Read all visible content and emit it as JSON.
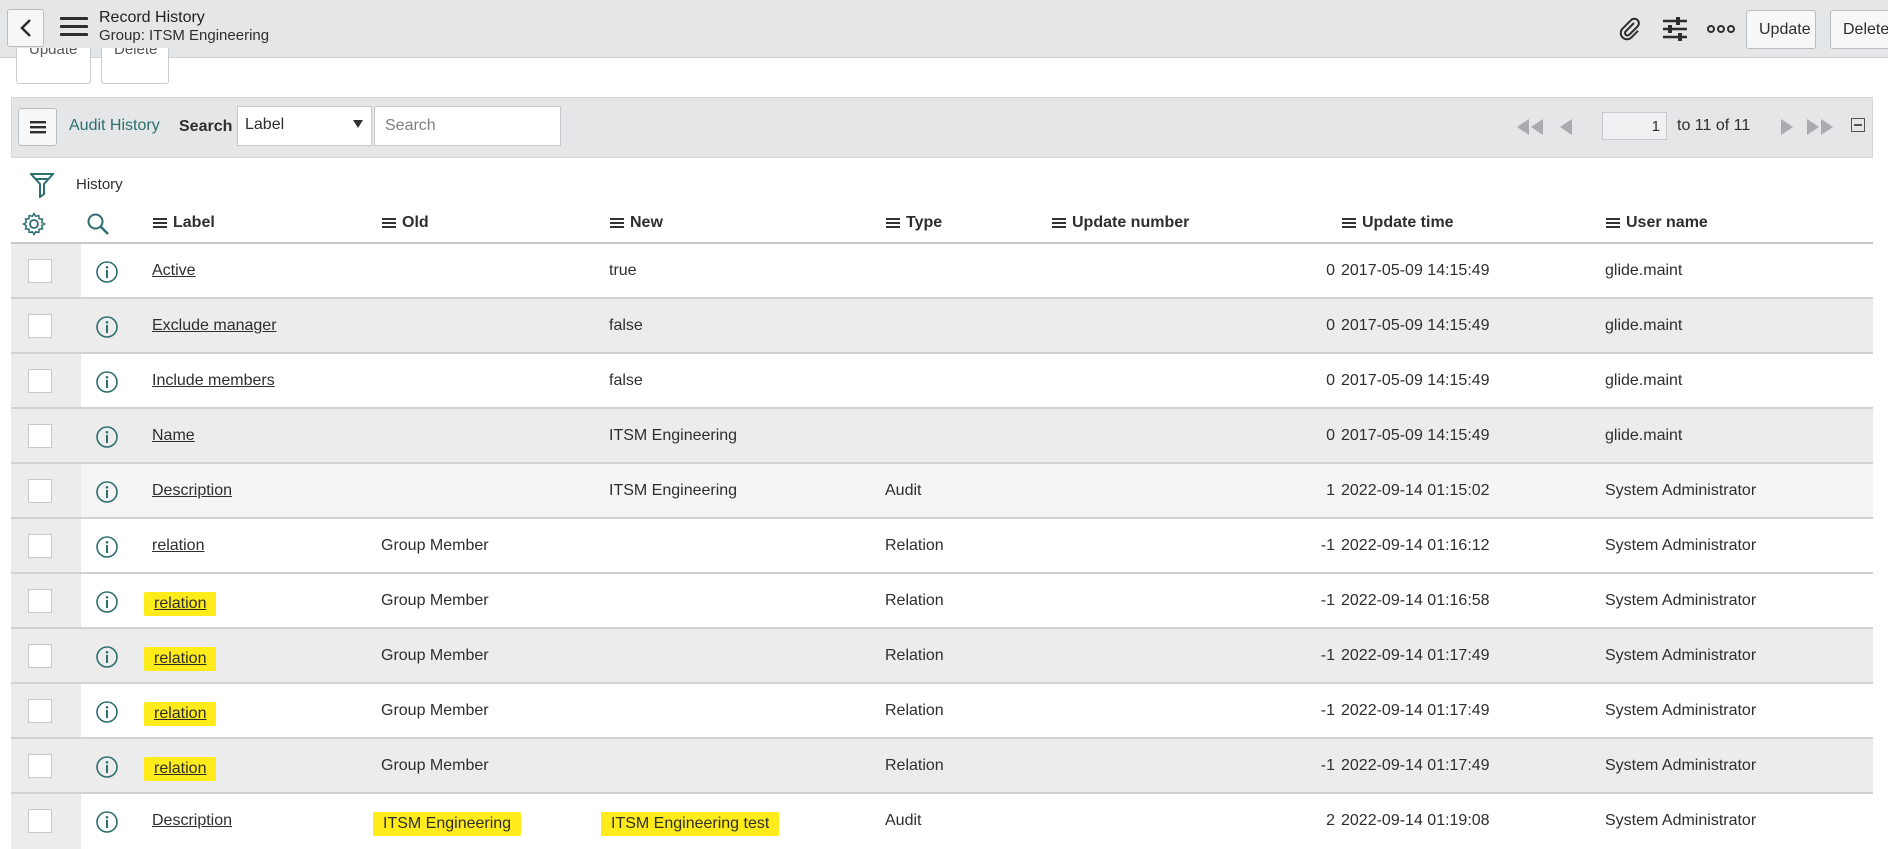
{
  "header": {
    "title": "Record History",
    "subtitle": "Group: ITSM Engineering",
    "update_label": "Update",
    "delete_label": "Delete"
  },
  "peek_buttons": {
    "update_label": "Update",
    "delete_label": "Delete"
  },
  "toolbar": {
    "list_title": "Audit History",
    "search_label": "Search",
    "search_field_selected": "Label",
    "search_placeholder": "Search",
    "page_current": "1",
    "page_range": "to 11 of 11"
  },
  "filter": {
    "breadcrumb": "History"
  },
  "columns": [
    "Label",
    "Old",
    "New",
    "Type",
    "Update number",
    "Update time",
    "User name"
  ],
  "rows": [
    {
      "label": "Active",
      "old": "",
      "new": "true",
      "type": "",
      "update_number": "0",
      "update_time": "2017-05-09 14:15:49",
      "user": "glide.maint"
    },
    {
      "label": "Exclude manager",
      "old": "",
      "new": "false",
      "type": "",
      "update_number": "0",
      "update_time": "2017-05-09 14:15:49",
      "user": "glide.maint"
    },
    {
      "label": "Include members",
      "old": "",
      "new": "false",
      "type": "",
      "update_number": "0",
      "update_time": "2017-05-09 14:15:49",
      "user": "glide.maint"
    },
    {
      "label": "Name",
      "old": "",
      "new": "ITSM Engineering",
      "type": "",
      "update_number": "0",
      "update_time": "2017-05-09 14:15:49",
      "user": "glide.maint"
    },
    {
      "label": "Description",
      "old": "",
      "new": "ITSM Engineering",
      "type": "Audit",
      "update_number": "1",
      "update_time": "2022-09-14 01:15:02",
      "user": "System Administrator"
    },
    {
      "label": "relation",
      "old": "Group Member",
      "new": "",
      "type": "Relation",
      "update_number": "-1",
      "update_time": "2022-09-14 01:16:12",
      "user": "System Administrator"
    },
    {
      "label": "relation",
      "old": "Group Member",
      "new": "",
      "type": "Relation",
      "update_number": "-1",
      "update_time": "2022-09-14 01:16:58",
      "user": "System Administrator"
    },
    {
      "label": "relation",
      "old": "Group Member",
      "new": "",
      "type": "Relation",
      "update_number": "-1",
      "update_time": "2022-09-14 01:17:49",
      "user": "System Administrator"
    },
    {
      "label": "relation",
      "old": "Group Member",
      "new": "",
      "type": "Relation",
      "update_number": "-1",
      "update_time": "2022-09-14 01:17:49",
      "user": "System Administrator"
    },
    {
      "label": "relation",
      "old": "Group Member",
      "new": "",
      "type": "Relation",
      "update_number": "-1",
      "update_time": "2022-09-14 01:17:49",
      "user": "System Administrator"
    },
    {
      "label": "Description",
      "old": "ITSM Engineering",
      "new": "ITSM Engineering test",
      "type": "Audit",
      "update_number": "2",
      "update_time": "2022-09-14 01:19:08",
      "user": "System Administrator"
    }
  ],
  "colors": {
    "accent": "#2d6e6f",
    "highlight": "#ffec1a",
    "header_bg": "#e4e6e7",
    "row_alt": "#ececec"
  },
  "icons": [
    "back-arrow-icon",
    "hamburger-menu-icon",
    "paperclip-icon",
    "sliders-icon",
    "more-options-icon",
    "filter-funnel-icon",
    "gear-icon",
    "search-icon",
    "info-icon"
  ]
}
